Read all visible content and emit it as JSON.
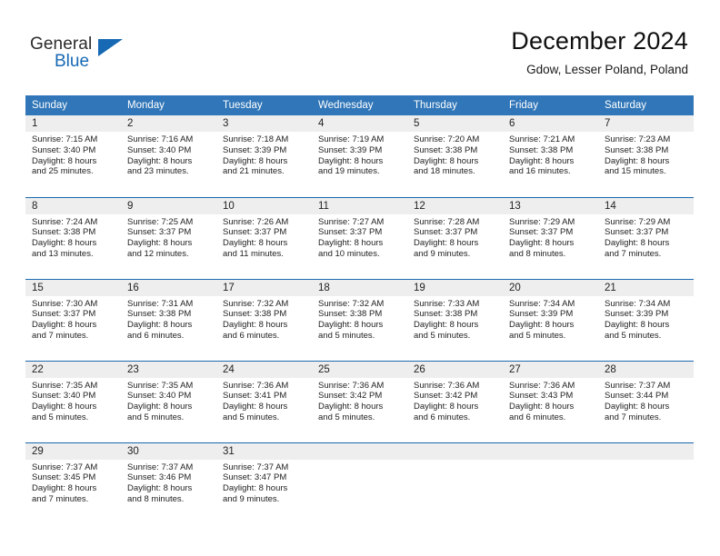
{
  "brand": {
    "name_top": "General",
    "name_bottom": "Blue",
    "triangle_color": "#1769b4"
  },
  "header": {
    "title": "December 2024",
    "location": "Gdow, Lesser Poland, Poland"
  },
  "calendar": {
    "header_color": "#3076b8",
    "daynum_background": "#eeeeee",
    "row_border_color": "#1a69b0",
    "weekday_headers": [
      "Sunday",
      "Monday",
      "Tuesday",
      "Wednesday",
      "Thursday",
      "Friday",
      "Saturday"
    ],
    "weeks": [
      [
        {
          "day": "1",
          "sunrise": "Sunrise: 7:15 AM",
          "sunset": "Sunset: 3:40 PM",
          "daylight_line1": "Daylight: 8 hours",
          "daylight_line2": "and 25 minutes."
        },
        {
          "day": "2",
          "sunrise": "Sunrise: 7:16 AM",
          "sunset": "Sunset: 3:40 PM",
          "daylight_line1": "Daylight: 8 hours",
          "daylight_line2": "and 23 minutes."
        },
        {
          "day": "3",
          "sunrise": "Sunrise: 7:18 AM",
          "sunset": "Sunset: 3:39 PM",
          "daylight_line1": "Daylight: 8 hours",
          "daylight_line2": "and 21 minutes."
        },
        {
          "day": "4",
          "sunrise": "Sunrise: 7:19 AM",
          "sunset": "Sunset: 3:39 PM",
          "daylight_line1": "Daylight: 8 hours",
          "daylight_line2": "and 19 minutes."
        },
        {
          "day": "5",
          "sunrise": "Sunrise: 7:20 AM",
          "sunset": "Sunset: 3:38 PM",
          "daylight_line1": "Daylight: 8 hours",
          "daylight_line2": "and 18 minutes."
        },
        {
          "day": "6",
          "sunrise": "Sunrise: 7:21 AM",
          "sunset": "Sunset: 3:38 PM",
          "daylight_line1": "Daylight: 8 hours",
          "daylight_line2": "and 16 minutes."
        },
        {
          "day": "7",
          "sunrise": "Sunrise: 7:23 AM",
          "sunset": "Sunset: 3:38 PM",
          "daylight_line1": "Daylight: 8 hours",
          "daylight_line2": "and 15 minutes."
        }
      ],
      [
        {
          "day": "8",
          "sunrise": "Sunrise: 7:24 AM",
          "sunset": "Sunset: 3:38 PM",
          "daylight_line1": "Daylight: 8 hours",
          "daylight_line2": "and 13 minutes."
        },
        {
          "day": "9",
          "sunrise": "Sunrise: 7:25 AM",
          "sunset": "Sunset: 3:37 PM",
          "daylight_line1": "Daylight: 8 hours",
          "daylight_line2": "and 12 minutes."
        },
        {
          "day": "10",
          "sunrise": "Sunrise: 7:26 AM",
          "sunset": "Sunset: 3:37 PM",
          "daylight_line1": "Daylight: 8 hours",
          "daylight_line2": "and 11 minutes."
        },
        {
          "day": "11",
          "sunrise": "Sunrise: 7:27 AM",
          "sunset": "Sunset: 3:37 PM",
          "daylight_line1": "Daylight: 8 hours",
          "daylight_line2": "and 10 minutes."
        },
        {
          "day": "12",
          "sunrise": "Sunrise: 7:28 AM",
          "sunset": "Sunset: 3:37 PM",
          "daylight_line1": "Daylight: 8 hours",
          "daylight_line2": "and 9 minutes."
        },
        {
          "day": "13",
          "sunrise": "Sunrise: 7:29 AM",
          "sunset": "Sunset: 3:37 PM",
          "daylight_line1": "Daylight: 8 hours",
          "daylight_line2": "and 8 minutes."
        },
        {
          "day": "14",
          "sunrise": "Sunrise: 7:29 AM",
          "sunset": "Sunset: 3:37 PM",
          "daylight_line1": "Daylight: 8 hours",
          "daylight_line2": "and 7 minutes."
        }
      ],
      [
        {
          "day": "15",
          "sunrise": "Sunrise: 7:30 AM",
          "sunset": "Sunset: 3:37 PM",
          "daylight_line1": "Daylight: 8 hours",
          "daylight_line2": "and 7 minutes."
        },
        {
          "day": "16",
          "sunrise": "Sunrise: 7:31 AM",
          "sunset": "Sunset: 3:38 PM",
          "daylight_line1": "Daylight: 8 hours",
          "daylight_line2": "and 6 minutes."
        },
        {
          "day": "17",
          "sunrise": "Sunrise: 7:32 AM",
          "sunset": "Sunset: 3:38 PM",
          "daylight_line1": "Daylight: 8 hours",
          "daylight_line2": "and 6 minutes."
        },
        {
          "day": "18",
          "sunrise": "Sunrise: 7:32 AM",
          "sunset": "Sunset: 3:38 PM",
          "daylight_line1": "Daylight: 8 hours",
          "daylight_line2": "and 5 minutes."
        },
        {
          "day": "19",
          "sunrise": "Sunrise: 7:33 AM",
          "sunset": "Sunset: 3:38 PM",
          "daylight_line1": "Daylight: 8 hours",
          "daylight_line2": "and 5 minutes."
        },
        {
          "day": "20",
          "sunrise": "Sunrise: 7:34 AM",
          "sunset": "Sunset: 3:39 PM",
          "daylight_line1": "Daylight: 8 hours",
          "daylight_line2": "and 5 minutes."
        },
        {
          "day": "21",
          "sunrise": "Sunrise: 7:34 AM",
          "sunset": "Sunset: 3:39 PM",
          "daylight_line1": "Daylight: 8 hours",
          "daylight_line2": "and 5 minutes."
        }
      ],
      [
        {
          "day": "22",
          "sunrise": "Sunrise: 7:35 AM",
          "sunset": "Sunset: 3:40 PM",
          "daylight_line1": "Daylight: 8 hours",
          "daylight_line2": "and 5 minutes."
        },
        {
          "day": "23",
          "sunrise": "Sunrise: 7:35 AM",
          "sunset": "Sunset: 3:40 PM",
          "daylight_line1": "Daylight: 8 hours",
          "daylight_line2": "and 5 minutes."
        },
        {
          "day": "24",
          "sunrise": "Sunrise: 7:36 AM",
          "sunset": "Sunset: 3:41 PM",
          "daylight_line1": "Daylight: 8 hours",
          "daylight_line2": "and 5 minutes."
        },
        {
          "day": "25",
          "sunrise": "Sunrise: 7:36 AM",
          "sunset": "Sunset: 3:42 PM",
          "daylight_line1": "Daylight: 8 hours",
          "daylight_line2": "and 5 minutes."
        },
        {
          "day": "26",
          "sunrise": "Sunrise: 7:36 AM",
          "sunset": "Sunset: 3:42 PM",
          "daylight_line1": "Daylight: 8 hours",
          "daylight_line2": "and 6 minutes."
        },
        {
          "day": "27",
          "sunrise": "Sunrise: 7:36 AM",
          "sunset": "Sunset: 3:43 PM",
          "daylight_line1": "Daylight: 8 hours",
          "daylight_line2": "and 6 minutes."
        },
        {
          "day": "28",
          "sunrise": "Sunrise: 7:37 AM",
          "sunset": "Sunset: 3:44 PM",
          "daylight_line1": "Daylight: 8 hours",
          "daylight_line2": "and 7 minutes."
        }
      ],
      [
        {
          "day": "29",
          "sunrise": "Sunrise: 7:37 AM",
          "sunset": "Sunset: 3:45 PM",
          "daylight_line1": "Daylight: 8 hours",
          "daylight_line2": "and 7 minutes."
        },
        {
          "day": "30",
          "sunrise": "Sunrise: 7:37 AM",
          "sunset": "Sunset: 3:46 PM",
          "daylight_line1": "Daylight: 8 hours",
          "daylight_line2": "and 8 minutes."
        },
        {
          "day": "31",
          "sunrise": "Sunrise: 7:37 AM",
          "sunset": "Sunset: 3:47 PM",
          "daylight_line1": "Daylight: 8 hours",
          "daylight_line2": "and 9 minutes."
        },
        {
          "day": "",
          "sunrise": "",
          "sunset": "",
          "daylight_line1": "",
          "daylight_line2": ""
        },
        {
          "day": "",
          "sunrise": "",
          "sunset": "",
          "daylight_line1": "",
          "daylight_line2": ""
        },
        {
          "day": "",
          "sunrise": "",
          "sunset": "",
          "daylight_line1": "",
          "daylight_line2": ""
        },
        {
          "day": "",
          "sunrise": "",
          "sunset": "",
          "daylight_line1": "",
          "daylight_line2": ""
        }
      ]
    ]
  }
}
